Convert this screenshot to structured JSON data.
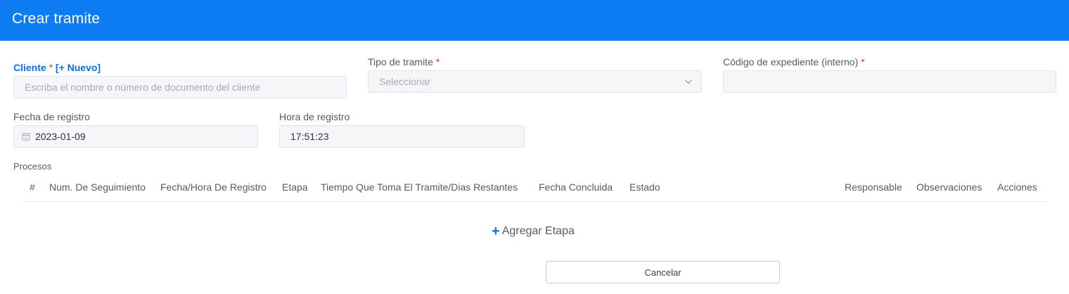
{
  "header": {
    "title": "Crear tramite"
  },
  "form": {
    "cliente": {
      "label": "Cliente",
      "required_mark": "*",
      "new_link": "[+ Nuevo]",
      "placeholder": "Escriba el nombre o número de documento del cliente"
    },
    "tipo_tramite": {
      "label": "Tipo de tramite",
      "required_mark": "*",
      "selected": "Seleccionar"
    },
    "codigo_expediente": {
      "label": "Código de expediente (interno)",
      "required_mark": "*",
      "value": ""
    },
    "fecha_registro": {
      "label": "Fecha de registro",
      "value": "2023-01-09"
    },
    "hora_registro": {
      "label": "Hora de registro",
      "value": "17:51:23"
    }
  },
  "procesos": {
    "label": "Procesos",
    "columns": [
      "#",
      "Num. De Seguimiento",
      "Fecha/Hora De Registro",
      "Etapa",
      "Tiempo Que Toma El Tramite/Dias Restantes",
      "Fecha Concluida",
      "Estado",
      "Responsable",
      "Observaciones",
      "Acciones"
    ],
    "rows": [],
    "add_stage": {
      "icon": "plus-icon",
      "label": "Agregar Etapa"
    }
  },
  "actions": {
    "cancel_label": "Cancelar"
  },
  "colors": {
    "header_bg": "#0d7cf2",
    "accent": "#0d6fe0",
    "required": "#e53935"
  }
}
